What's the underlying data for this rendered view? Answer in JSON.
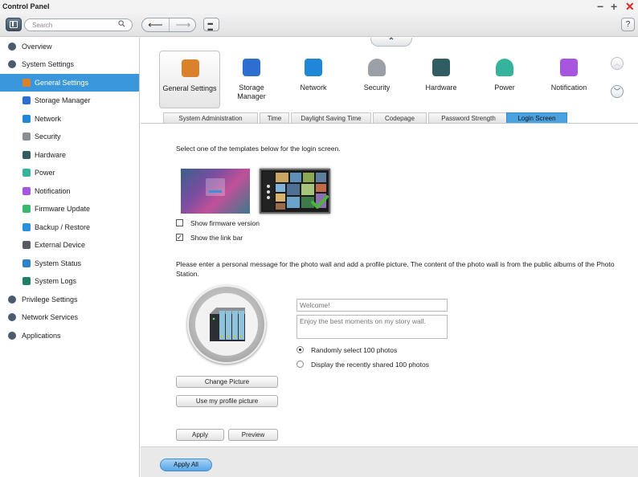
{
  "window": {
    "title": "Control Panel"
  },
  "toolbar": {
    "search_placeholder": "Search",
    "help": "?"
  },
  "sidebar": {
    "items": [
      {
        "label": "Overview",
        "icon": "overview-icon",
        "level": "top",
        "color": "#4a5b70"
      },
      {
        "label": "System Settings",
        "icon": "gear-icon",
        "level": "top",
        "color": "#4a5b70"
      },
      {
        "label": "General Settings",
        "icon": "general-settings-icon",
        "level": "sub",
        "active": true,
        "color": "#d9822b"
      },
      {
        "label": "Storage Manager",
        "icon": "storage-icon",
        "level": "sub",
        "color": "#2c6fd0"
      },
      {
        "label": "Network",
        "icon": "network-icon",
        "level": "sub",
        "color": "#1f86d8"
      },
      {
        "label": "Security",
        "icon": "lock-icon",
        "level": "sub",
        "color": "#8a8f96"
      },
      {
        "label": "Hardware",
        "icon": "hardware-icon",
        "level": "sub",
        "color": "#2f5d62"
      },
      {
        "label": "Power",
        "icon": "power-bulb-icon",
        "level": "sub",
        "color": "#36b39c"
      },
      {
        "label": "Notification",
        "icon": "notification-icon",
        "level": "sub",
        "color": "#a855e0"
      },
      {
        "label": "Firmware Update",
        "icon": "firmware-icon",
        "level": "sub",
        "color": "#3ab96e"
      },
      {
        "label": "Backup / Restore",
        "icon": "backup-icon",
        "level": "sub",
        "color": "#2a8fdc"
      },
      {
        "label": "External Device",
        "icon": "external-device-icon",
        "level": "sub",
        "color": "#555c66"
      },
      {
        "label": "System Status",
        "icon": "system-status-icon",
        "level": "sub",
        "color": "#2f7fd0"
      },
      {
        "label": "System Logs",
        "icon": "system-logs-icon",
        "level": "sub",
        "color": "#1e7f6b"
      },
      {
        "label": "Privilege Settings",
        "icon": "user-icon",
        "level": "top",
        "color": "#4a5b70"
      },
      {
        "label": "Network Services",
        "icon": "globe-icon",
        "level": "top",
        "color": "#4a5b70"
      },
      {
        "label": "Applications",
        "icon": "applications-icon",
        "level": "top",
        "color": "#4a5b70"
      }
    ]
  },
  "categories": [
    {
      "label": "General Settings",
      "icon": "general-settings-icon",
      "active": true
    },
    {
      "label": "Storage Manager",
      "icon": "storage-icon"
    },
    {
      "label": "Network",
      "icon": "network-icon"
    },
    {
      "label": "Security",
      "icon": "lock-icon"
    },
    {
      "label": "Hardware",
      "icon": "hardware-icon"
    },
    {
      "label": "Power",
      "icon": "power-bulb-icon"
    },
    {
      "label": "Notification",
      "icon": "notification-icon"
    }
  ],
  "tabs": [
    {
      "label": "System Administration"
    },
    {
      "label": "Time"
    },
    {
      "label": "Daylight Saving Time"
    },
    {
      "label": "Codepage"
    },
    {
      "label": "Password Strength"
    },
    {
      "label": "Login Screen",
      "active": true
    }
  ],
  "login_screen": {
    "intro": "Select one of the templates below for the login screen.",
    "show_firmware_label": "Show firmware version",
    "show_firmware_checked": false,
    "show_link_bar_label": "Show the link bar",
    "show_link_bar_checked": true,
    "message_intro": "Please enter a personal message for the photo wall and add a profile picture. The content of the photo wall is from the public albums of the Photo Station.",
    "title_value": "Welcome!",
    "description_value": "Enjoy the best moments on my story wall.",
    "radio_random_label": "Randomly select 100 photos",
    "radio_recent_label": "Display the recently shared 100 photos",
    "selected_option": "random",
    "change_picture_label": "Change Picture",
    "use_profile_label": "Use my profile picture",
    "apply_label": "Apply",
    "preview_label": "Preview"
  },
  "footer": {
    "apply_all_label": "Apply All"
  }
}
